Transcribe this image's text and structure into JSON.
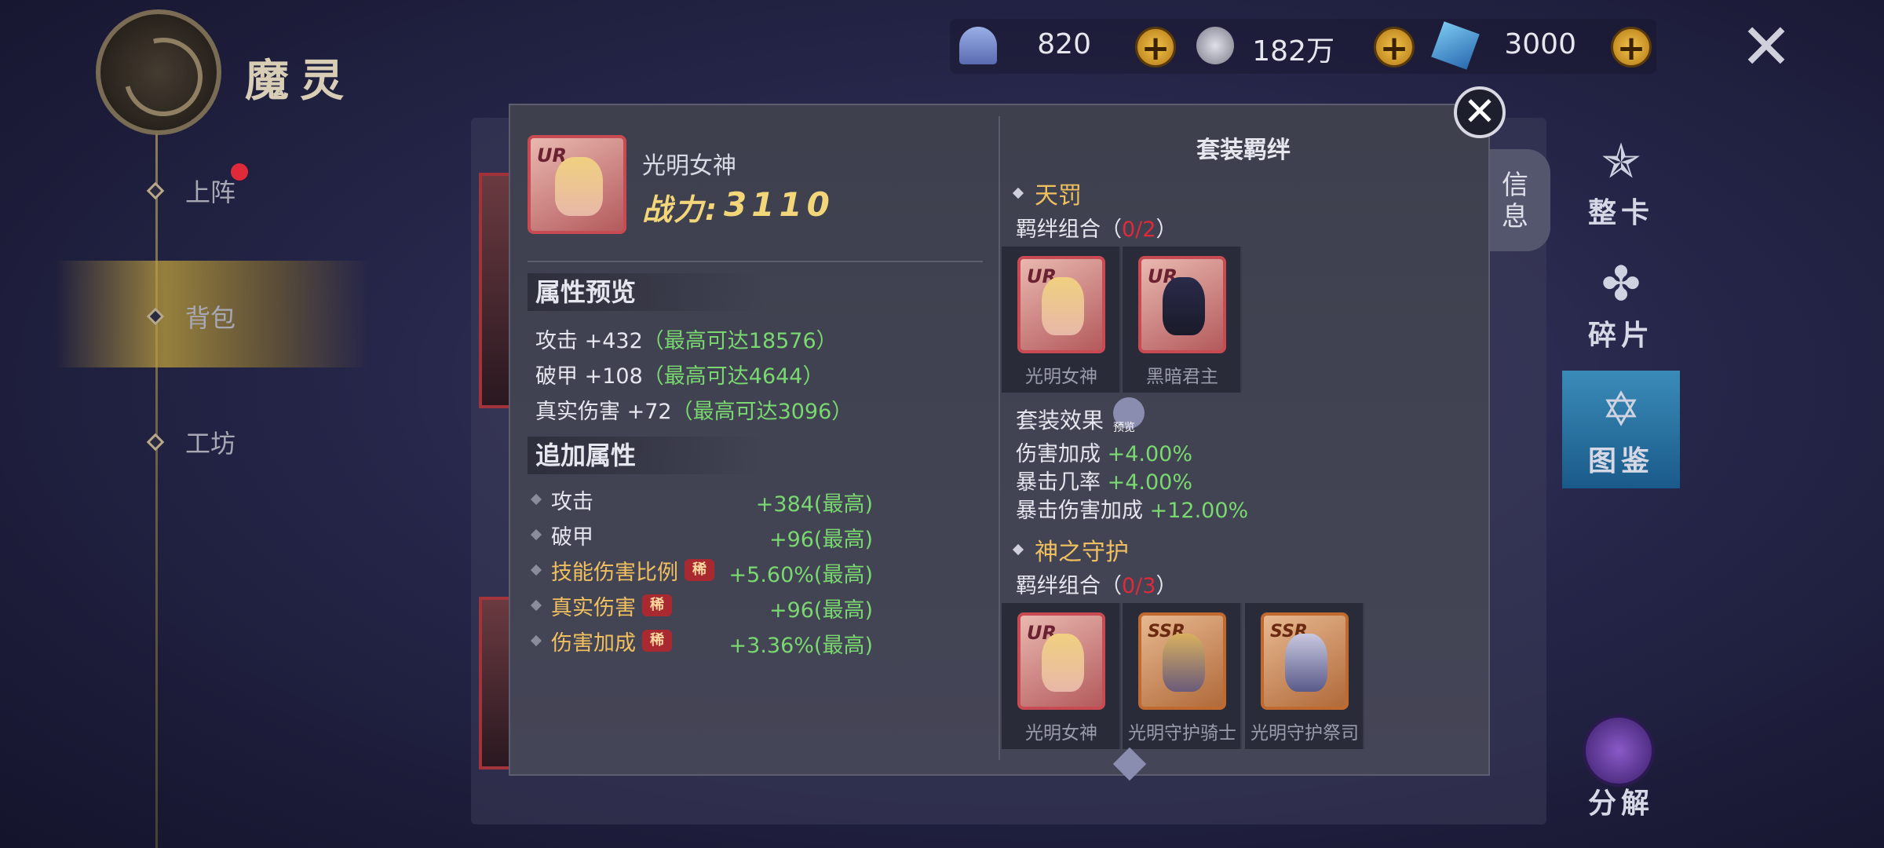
{
  "app": {
    "title": "魔灵"
  },
  "nav": {
    "items": [
      {
        "label": "上阵"
      },
      {
        "label": "背包"
      },
      {
        "label": "工坊"
      }
    ]
  },
  "currency": [
    {
      "icon": "shell-icon",
      "value": "820"
    },
    {
      "icon": "coin-icon",
      "value": "182万"
    },
    {
      "icon": "crystal-icon",
      "value": "3000"
    }
  ],
  "right_menu": [
    {
      "label": "整卡",
      "icon": "star-card-icon"
    },
    {
      "label": "碎片",
      "icon": "puzzle-icon"
    },
    {
      "label": "图鉴",
      "icon": "book-icon"
    },
    {
      "label": "分解",
      "icon": "decompose-icon"
    }
  ],
  "info_tab": {
    "label": "信息"
  },
  "modal": {
    "hero": {
      "rarity": "UR",
      "name": "光明女神",
      "power_label": "战力:",
      "power": "3110"
    },
    "attr_preview": {
      "title": "属性预览",
      "lines": [
        {
          "name": "攻击",
          "value": "+432",
          "max": "（最高可达18576）"
        },
        {
          "name": "破甲",
          "value": "+108",
          "max": "（最高可达4644）"
        },
        {
          "name": "真实伤害",
          "value": "+72",
          "max": "（最高可达3096）"
        }
      ]
    },
    "extra_attr": {
      "title": "追加属性",
      "rows": [
        {
          "name": "攻击",
          "value": "+384(最高)",
          "rare": ""
        },
        {
          "name": "破甲",
          "value": "+96(最高)",
          "rare": ""
        },
        {
          "name": "技能伤害比例",
          "value": "+5.60%(最高)",
          "rare": "稀"
        },
        {
          "name": "真实伤害",
          "value": "+96(最高)",
          "rare": "稀"
        },
        {
          "name": "伤害加成",
          "value": "+3.36%(最高)",
          "rare": "稀"
        }
      ]
    },
    "set_bonds": {
      "title": "套装羁绊",
      "sets": [
        {
          "name": "天罚",
          "combo_label": "羁绊组合（",
          "combo_count": "0/2",
          "combo_close": "）",
          "cards": [
            {
              "rarity": "UR",
              "name": "光明女神"
            },
            {
              "rarity": "UR",
              "name": "黑暗君主"
            }
          ],
          "effect_label": "套装效果",
          "preview_label": "预览",
          "effects": [
            {
              "name": "伤害加成",
              "value": "+4.00%"
            },
            {
              "name": "暴击几率",
              "value": "+4.00%"
            },
            {
              "name": "暴击伤害加成",
              "value": "+12.00%"
            }
          ]
        },
        {
          "name": "神之守护",
          "combo_label": "羁绊组合（",
          "combo_count": "0/3",
          "combo_close": "）",
          "cards": [
            {
              "rarity": "UR",
              "name": "光明女神"
            },
            {
              "rarity": "SSR",
              "name": "光明守护骑士"
            },
            {
              "rarity": "SSR",
              "name": "光明守护祭司"
            }
          ]
        }
      ]
    }
  },
  "colors": {
    "gold": "#f0c060",
    "green": "#7ad870",
    "red": "#e02a3a",
    "panel": "#3e404e"
  }
}
